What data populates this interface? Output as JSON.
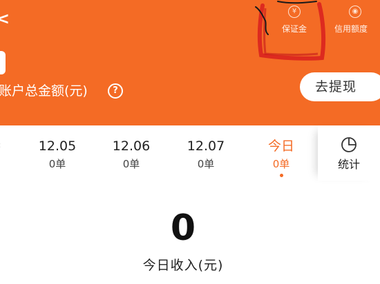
{
  "header": {
    "total_label": "账户总金额(元)",
    "help_icon": "question-circle-icon",
    "withdraw_label": "去提现",
    "deposit": {
      "icon": "yen-shield-icon",
      "icon_glyph": "¥",
      "label": "保证金"
    },
    "credit": {
      "icon": "target-circle-icon",
      "icon_glyph": "◉",
      "label": "信用额度"
    },
    "help_glyph": "?",
    "back_glyph": "<"
  },
  "dates": [
    {
      "date": "12.05",
      "orders": "0单",
      "active": false
    },
    {
      "date": "12.06",
      "orders": "0单",
      "active": false
    },
    {
      "date": "12.07",
      "orders": "0单",
      "active": false
    },
    {
      "date": "今日",
      "orders": "0单",
      "active": true
    }
  ],
  "stats": {
    "label": "统计",
    "icon": "pie-chart-icon"
  },
  "income": {
    "value": "0",
    "label": "今日收入(元)"
  },
  "colors": {
    "accent": "#f46b25",
    "annotation": "#d81e1e"
  }
}
